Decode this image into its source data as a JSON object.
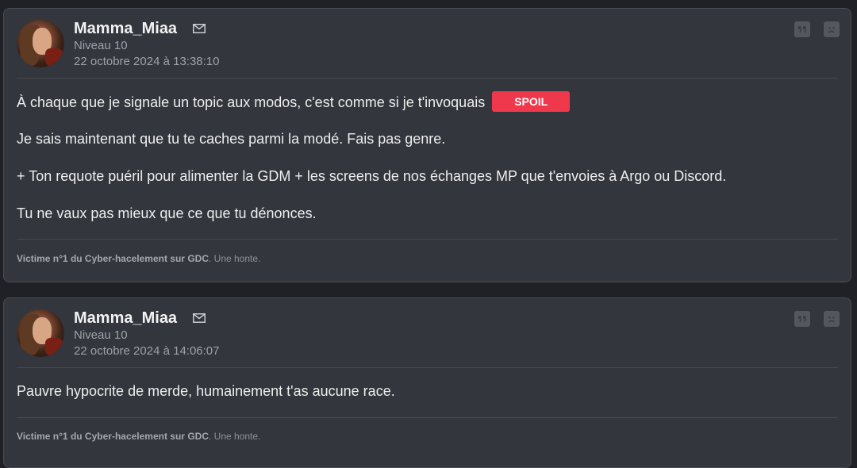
{
  "posts": [
    {
      "username": "Mamma_Miaa",
      "level": "Niveau 10",
      "date": "22 octobre 2024 à 13:38:10",
      "lines": [
        "À chaque que je signale un topic aux modos, c'est comme si je t'invoquais",
        "Je sais maintenant que tu te caches parmi la modé. Fais pas genre.",
        "+ Ton requote puéril pour alimenter la GDM + les screens de nos échanges MP que t'envoies à Argo ou Discord.",
        "Tu ne vaux pas mieux que ce que tu dénonces."
      ],
      "spoil_label": "SPOIL",
      "signature_bold": "Victime n°1 du Cyber-hacelement sur GDC",
      "signature_rest": ". Une honte."
    },
    {
      "username": "Mamma_Miaa",
      "level": "Niveau 10",
      "date": "22 octobre 2024 à 14:06:07",
      "lines": [
        "Pauvre hypocrite de merde, humainement t'as aucune race."
      ],
      "signature_bold": "Victime n°1 du Cyber-hacelement sur GDC",
      "signature_rest": ". Une honte."
    }
  ],
  "icons": {
    "mail": "mail-icon",
    "quote": "quote-icon",
    "report": "sad-face-icon"
  },
  "colors": {
    "spoil_bg": "#f0384d",
    "post_bg": "#33363d",
    "page_bg": "#1f2126"
  }
}
